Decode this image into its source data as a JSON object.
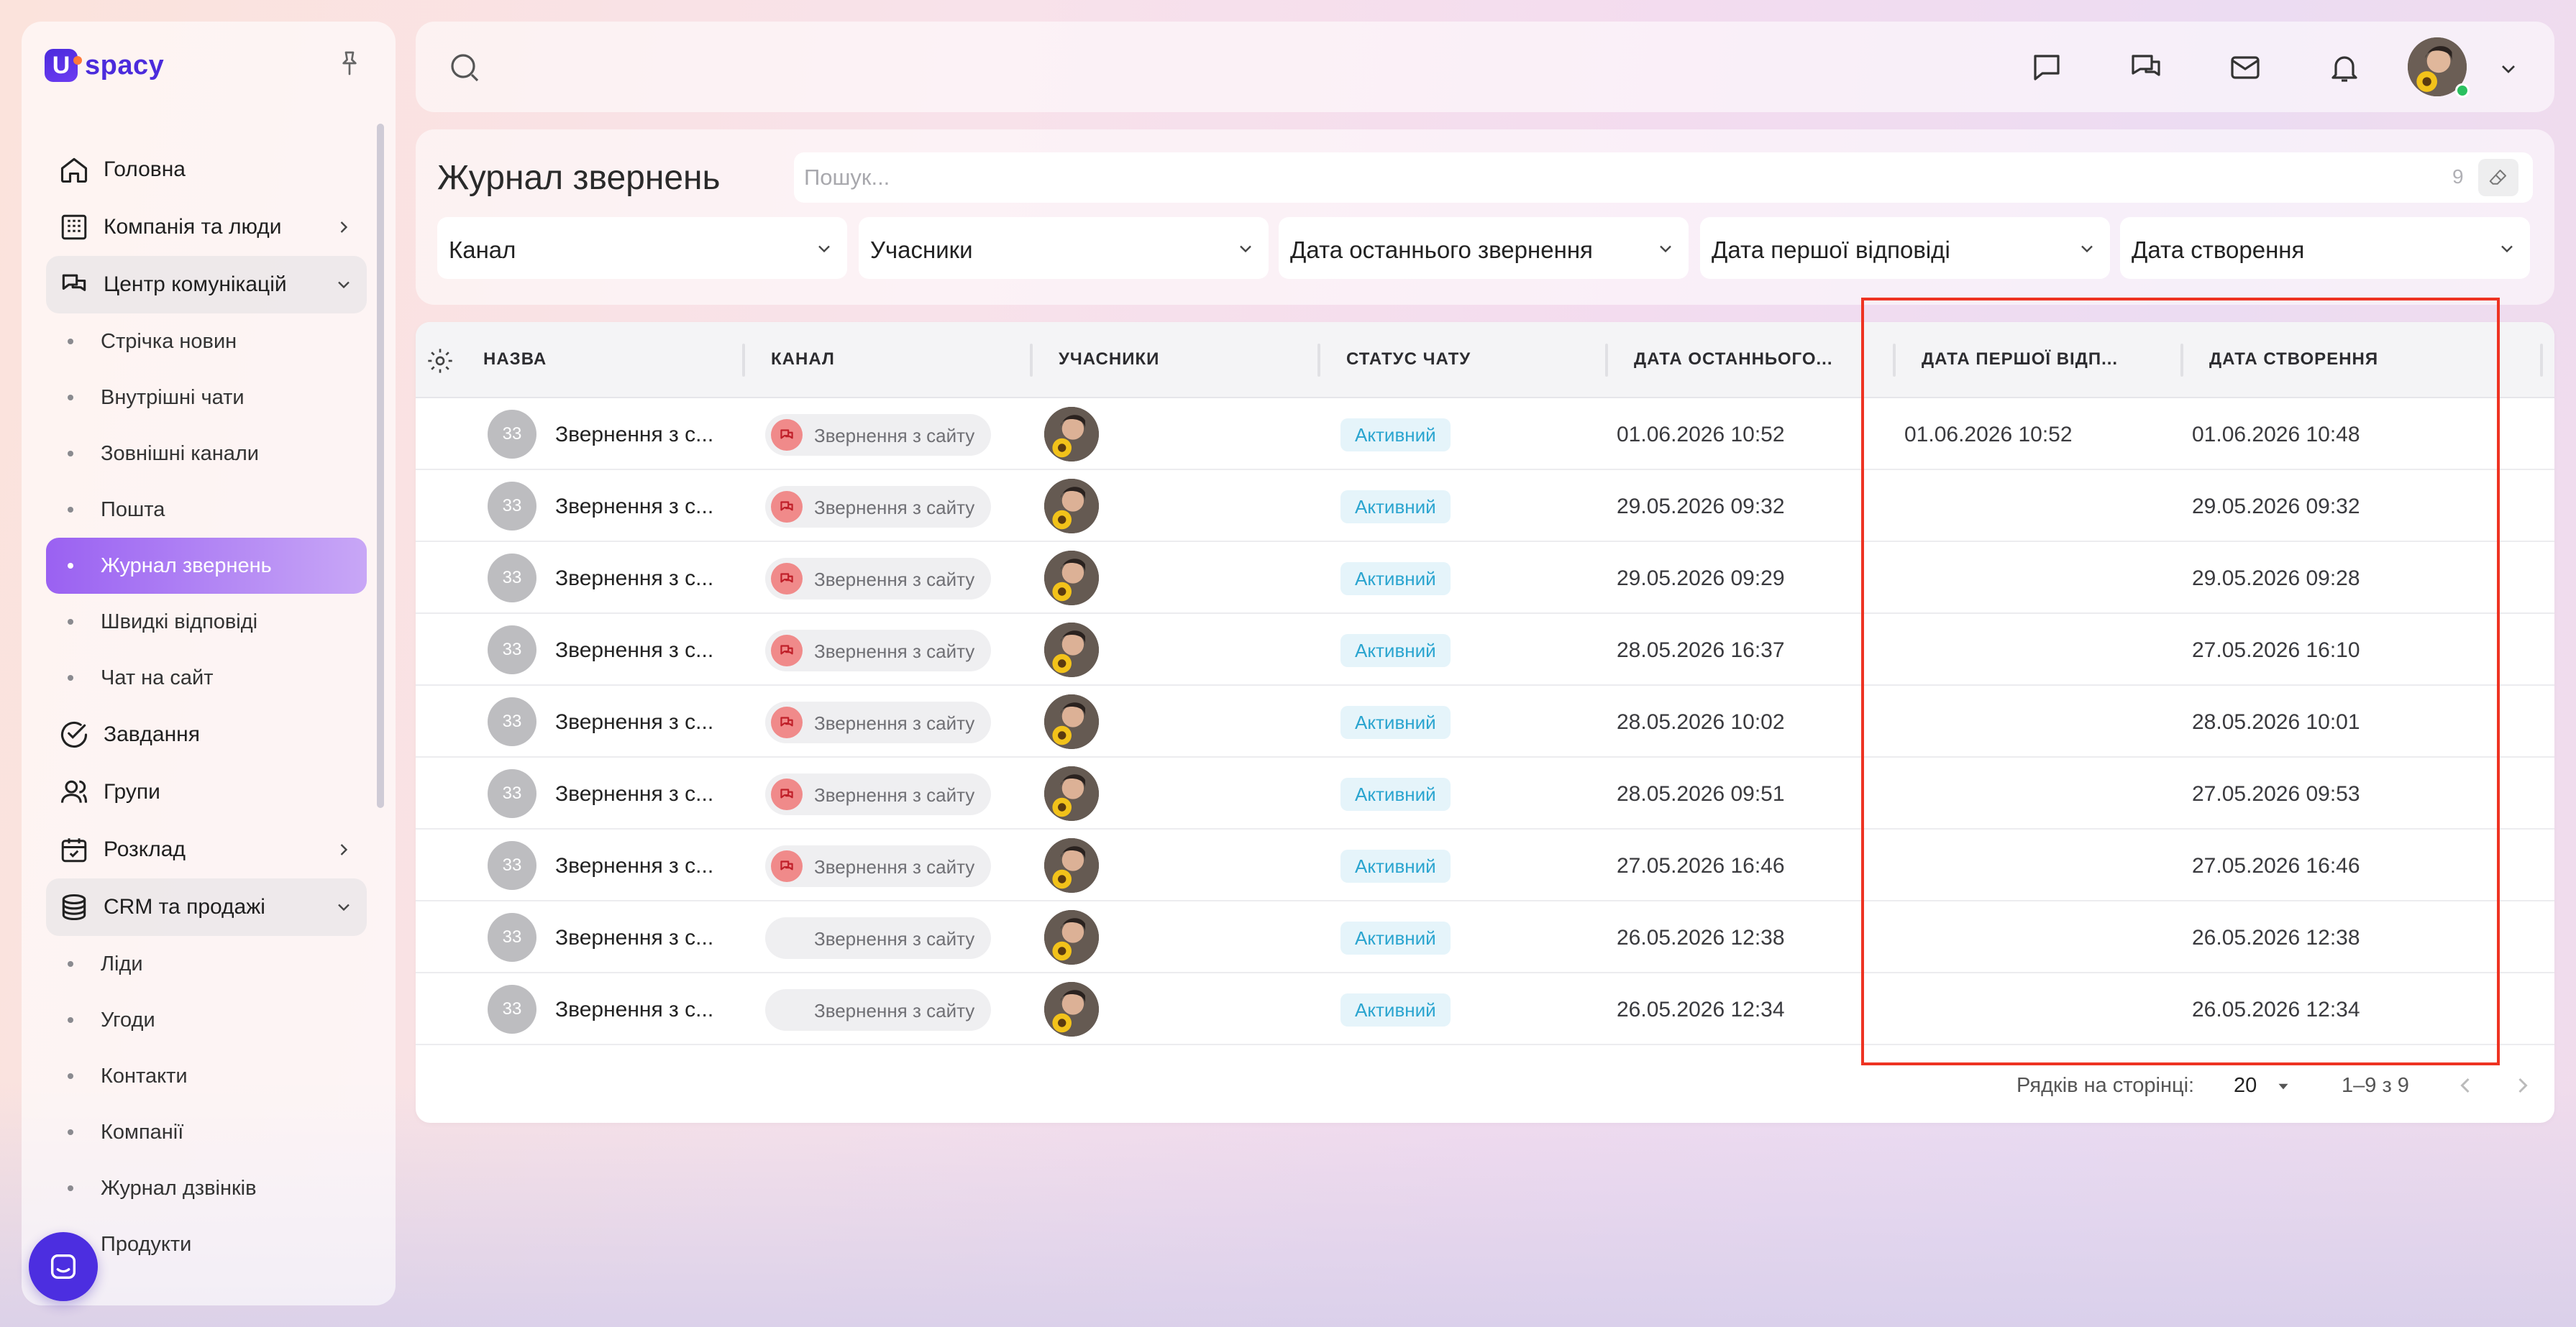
{
  "app": {
    "logo_letter": "U",
    "logo_text": "spacy",
    "brand_color": "#4b2bdc",
    "accent_color": "#9a61f2"
  },
  "sidebar": {
    "items": [
      {
        "label": "Головна",
        "icon": "home-icon"
      },
      {
        "label": "Компанія та люди",
        "icon": "building-icon"
      },
      {
        "label": "Центр комунікацій",
        "icon": "communication-icon"
      },
      {
        "label": "Стрічка новин"
      },
      {
        "label": "Внутрішні чати"
      },
      {
        "label": "Зовнішні канали"
      },
      {
        "label": "Пошта"
      },
      {
        "label": "Журнал звернень",
        "active": true
      },
      {
        "label": "Швидкі відповіді"
      },
      {
        "label": "Чат на сайт"
      },
      {
        "label": "Завдання",
        "icon": "check-circle-icon"
      },
      {
        "label": "Групи",
        "icon": "users-icon"
      },
      {
        "label": "Розклад",
        "icon": "calendar-icon"
      },
      {
        "label": "CRM та продажі",
        "icon": "coins-icon"
      },
      {
        "label": "Ліди"
      },
      {
        "label": "Угоди"
      },
      {
        "label": "Контакти"
      },
      {
        "label": "Компанії"
      },
      {
        "label": "Журнал дзвінків"
      },
      {
        "label": "Продукти"
      }
    ]
  },
  "page": {
    "title": "Журнал звернень",
    "search_placeholder": "Пошук...",
    "search_count": "9"
  },
  "filters": [
    "Канал",
    "Учасники",
    "Дата останнього звернення",
    "Дата першої відповіді",
    "Дата створення"
  ],
  "table": {
    "columns": [
      "НАЗВА",
      "КАНАЛ",
      "УЧАСНИКИ",
      "СТАТУС ЧАТУ",
      "ДАТА ОСТАННЬОГО...",
      "ДАТА ПЕРШОЇ ВІДП...",
      "ДАТА СТВОРЕННЯ"
    ],
    "rows": [
      {
        "num": "33",
        "name": "Звернення з с...",
        "channel": "Звернення з сайту",
        "status": "Активний",
        "last": "01.06.2026 10:52",
        "first": "01.06.2026 10:52",
        "created": "01.06.2026 10:48",
        "channel_icon": true
      },
      {
        "num": "33",
        "name": "Звернення з с...",
        "channel": "Звернення з сайту",
        "status": "Активний",
        "last": "29.05.2026 09:32",
        "first": "",
        "created": "29.05.2026 09:32",
        "channel_icon": true
      },
      {
        "num": "33",
        "name": "Звернення з с...",
        "channel": "Звернення з сайту",
        "status": "Активний",
        "last": "29.05.2026 09:29",
        "first": "",
        "created": "29.05.2026 09:28",
        "channel_icon": true
      },
      {
        "num": "33",
        "name": "Звернення з с...",
        "channel": "Звернення з сайту",
        "status": "Активний",
        "last": "28.05.2026 16:37",
        "first": "",
        "created": "27.05.2026 16:10",
        "channel_icon": true
      },
      {
        "num": "33",
        "name": "Звернення з с...",
        "channel": "Звернення з сайту",
        "status": "Активний",
        "last": "28.05.2026 10:02",
        "first": "",
        "created": "28.05.2026 10:01",
        "channel_icon": true
      },
      {
        "num": "33",
        "name": "Звернення з с...",
        "channel": "Звернення з сайту",
        "status": "Активний",
        "last": "28.05.2026 09:51",
        "first": "",
        "created": "27.05.2026 09:53",
        "channel_icon": true
      },
      {
        "num": "33",
        "name": "Звернення з с...",
        "channel": "Звернення з сайту",
        "status": "Активний",
        "last": "27.05.2026 16:46",
        "first": "",
        "created": "27.05.2026 16:46",
        "channel_icon": true
      },
      {
        "num": "33",
        "name": "Звернення з с...",
        "channel": "Звернення з сайту",
        "status": "Активний",
        "last": "26.05.2026 12:38",
        "first": "",
        "created": "26.05.2026 12:38",
        "channel_icon": false
      },
      {
        "num": "33",
        "name": "Звернення з с...",
        "channel": "Звернення з сайту",
        "status": "Активний",
        "last": "26.05.2026 12:34",
        "first": "",
        "created": "26.05.2026 12:34",
        "channel_icon": false
      }
    ],
    "footer": {
      "rows_per_page_label": "Рядків на сторінці:",
      "rows_per_page": "20",
      "range": "1–9 з 9"
    }
  },
  "annotation": {
    "highlight_color": "#ee3322"
  }
}
